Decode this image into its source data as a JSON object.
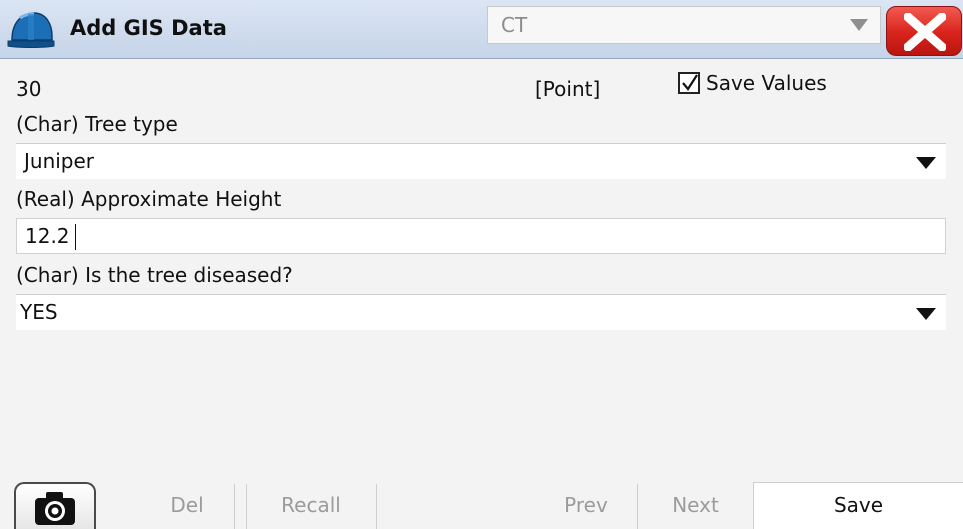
{
  "header": {
    "title": "Add GIS Data",
    "icon": "hard-hat-icon",
    "layer_select": {
      "value": "CT"
    },
    "close_icon": "close-x-icon",
    "close_color": "#d8231b"
  },
  "record": {
    "id": "30",
    "geometry_type": "[Point]",
    "save_values": {
      "label": "Save Values",
      "checked": true
    }
  },
  "fields": [
    {
      "label": "(Char) Tree type",
      "type": "dropdown",
      "value": "Juniper"
    },
    {
      "label": "(Real) Approximate Height",
      "type": "text",
      "value": "12.2"
    },
    {
      "label": "(Char) Is the tree diseased?",
      "type": "dropdown",
      "value": "YES"
    }
  ],
  "toolbar": {
    "camera_icon": "camera-icon",
    "del_label": "Del",
    "recall_label": "Recall",
    "prev_label": "Prev",
    "next_label": "Next",
    "save_label": "Save"
  }
}
